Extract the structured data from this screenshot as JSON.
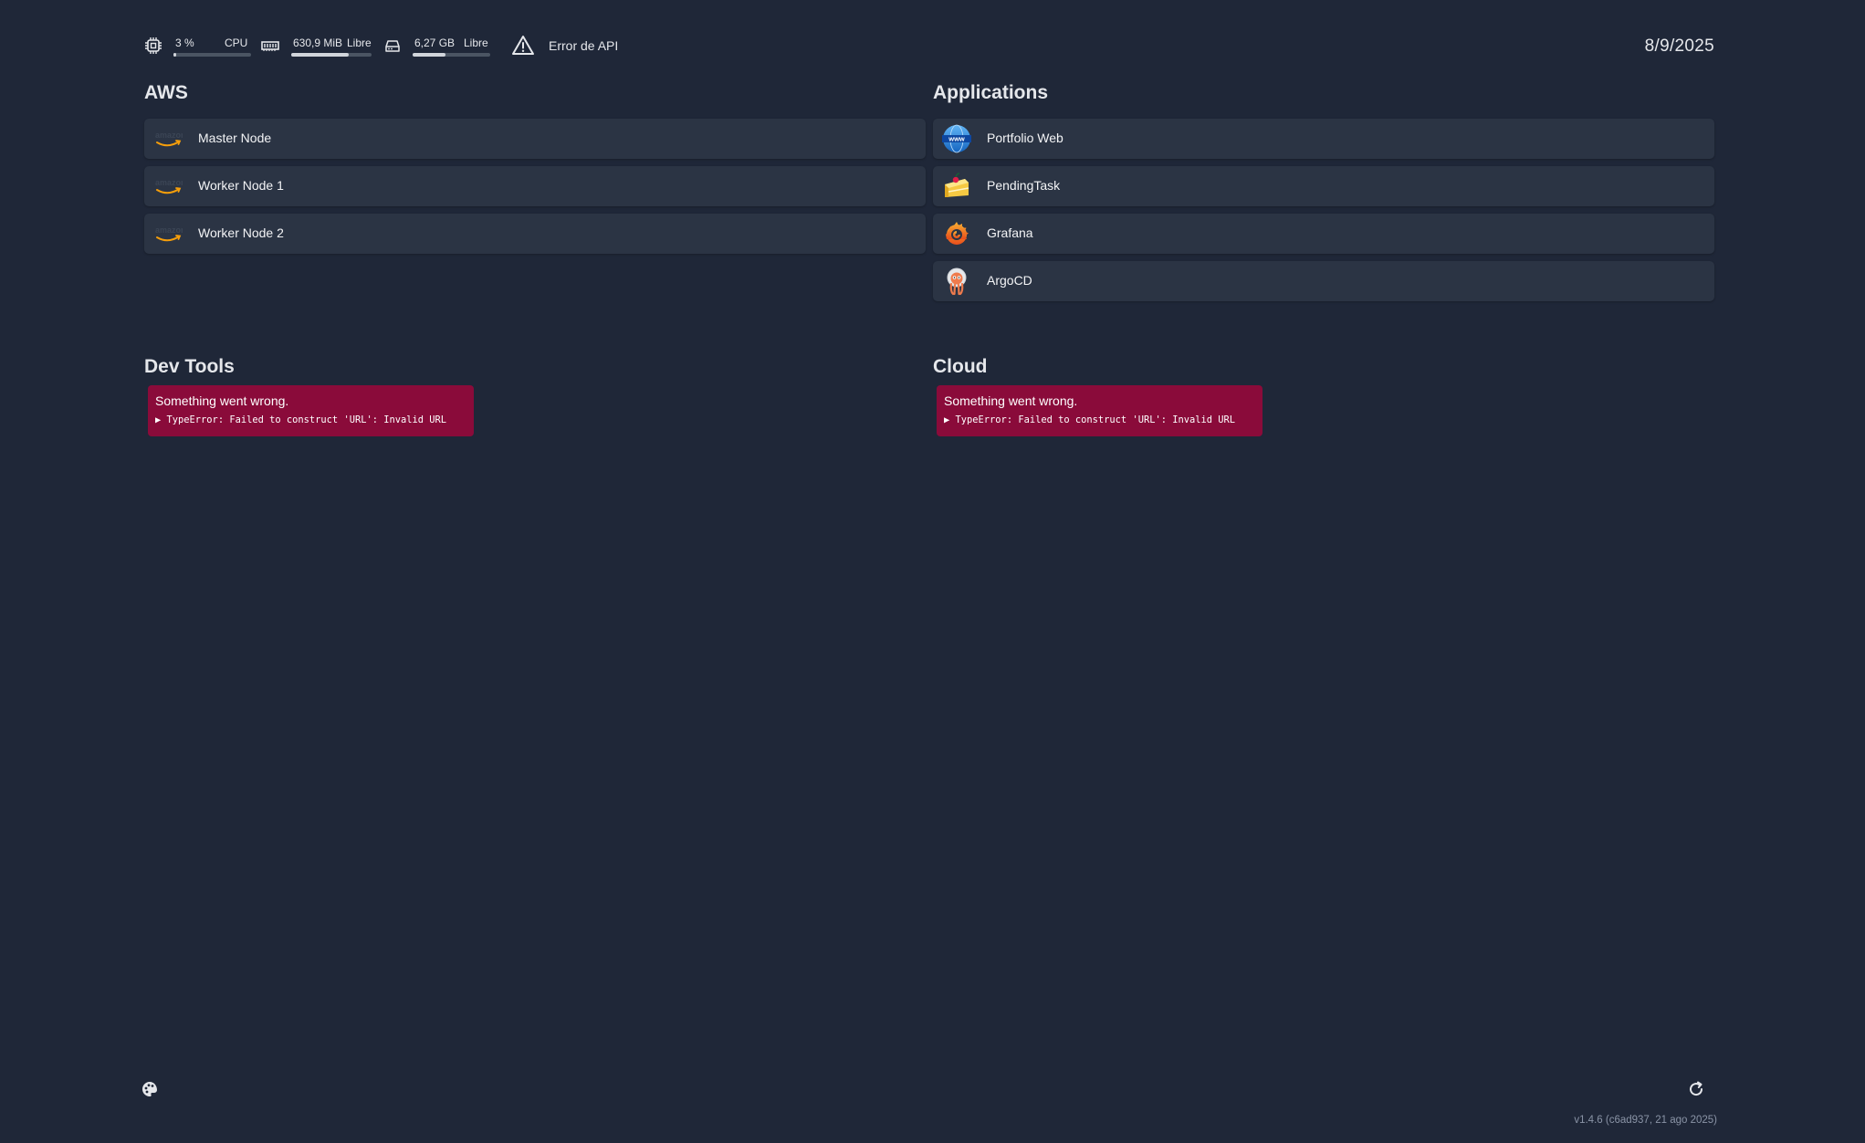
{
  "status_bar": {
    "cpu": {
      "value": "3 %",
      "label": "CPU",
      "usage_fraction": 0.03
    },
    "memory": {
      "value": "630,9 MiB",
      "label": "Libre",
      "usage_fraction": 0.72
    },
    "disk": {
      "value": "6,27 GB",
      "label": "Libre",
      "usage_fraction": 0.42
    },
    "api_error": "Error de API",
    "date": "8/9/2025"
  },
  "groups": {
    "aws": {
      "title": "AWS",
      "services": [
        {
          "name": "Master Node",
          "icon": "amazon-icon"
        },
        {
          "name": "Worker Node 1",
          "icon": "amazon-icon"
        },
        {
          "name": "Worker Node 2",
          "icon": "amazon-icon"
        }
      ]
    },
    "applications": {
      "title": "Applications",
      "services": [
        {
          "name": "Portfolio Web",
          "icon": "www-globe-icon"
        },
        {
          "name": "PendingTask",
          "icon": "cake-icon"
        },
        {
          "name": "Grafana",
          "icon": "grafana-icon"
        },
        {
          "name": "ArgoCD",
          "icon": "argocd-icon"
        }
      ]
    },
    "dev_tools": {
      "title": "Dev Tools",
      "error_title": "Something went wrong.",
      "error_detail": "▶ TypeError: Failed to construct 'URL': Invalid URL"
    },
    "cloud": {
      "title": "Cloud",
      "error_title": "Something went wrong.",
      "error_detail": "▶ TypeError: Failed to construct 'URL': Invalid URL"
    }
  },
  "footer": {
    "theme_icon": "palette-icon",
    "refresh_icon": "refresh-icon",
    "version": "v1.4.6 (c6ad937, 21 ago 2025)"
  },
  "colors": {
    "background": "#1f2738",
    "card": "#2b3444",
    "error": "#8a0b3a"
  }
}
